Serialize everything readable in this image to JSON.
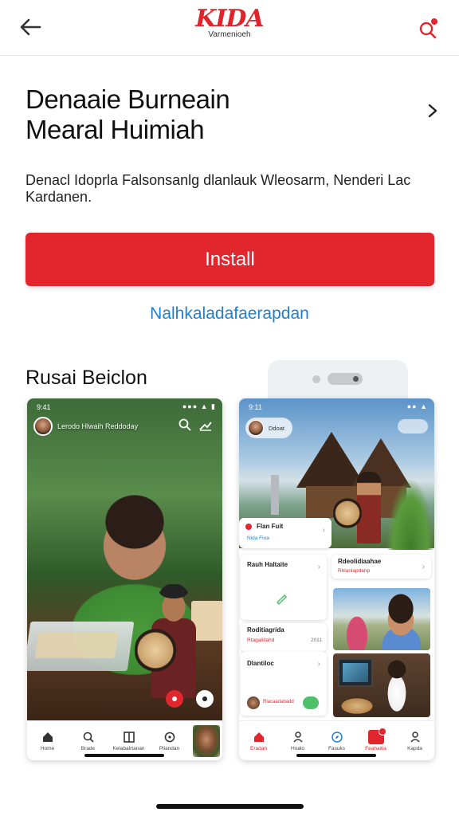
{
  "header": {
    "logo_text": "KIDA",
    "logo_sub": "Varmenioeh"
  },
  "app": {
    "title_line1": "Denaaie Burneain",
    "title_line2": "Mearal Huimiah",
    "description": "Denacl Idoprla Falsonsanlg dlanlauk Wleosarm, Nenderi Lac Kardanen.",
    "install_label": "Install",
    "secondary_link": "Nalhkaladafaerapdan"
  },
  "screenshots": {
    "section_title": "Rusai Beiclon",
    "phone1": {
      "status_time": "9:41",
      "status_icons": "●●● ▲ ▮",
      "channel_name": "Lerodo Hlwaih Reddoday",
      "tabs": [
        "Home",
        "Brade",
        "Kelabalrtanan",
        "Pliandan"
      ]
    },
    "phone2": {
      "status_time": "9:11",
      "status_icons": "●● ▲",
      "channel_name": "Ddoat",
      "card_fun_title": "Flan Fuit",
      "card_fun_sub": "Nlda Fioa",
      "card_a_title": "Rauh Haltaite",
      "card_b_title": "Roditiagrida",
      "card_b_sub": "Rtagaliitahd",
      "card_b_meta": "2011",
      "card_c_title": "Dlantiloc",
      "card_c_sub": "Rlacaadabadd",
      "card_d_title": "Rdeolidiaahae",
      "card_d_sub": "Rhlanlapdanp",
      "tabs": [
        "Eradan",
        "Hoalo",
        "Fasuks",
        "Feahaitia",
        "Kapda"
      ]
    }
  },
  "colors": {
    "brand_red": "#e2262d",
    "link_blue": "#1f7fd1"
  }
}
